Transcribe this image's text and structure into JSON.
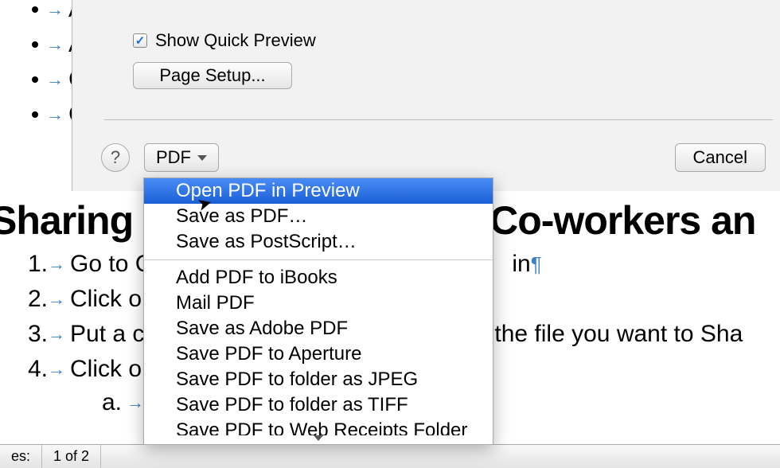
{
  "doc": {
    "bullets": [
      "A",
      "A",
      "C",
      "C"
    ],
    "heading_left": "Sharing",
    "heading_right": "Co-workers an",
    "num_items": {
      "1": "Go to C",
      "1_right": "in",
      "2": "Click on",
      "3_left": "Put a c",
      "3_right": "the file you want to Sha",
      "4": "Click on"
    },
    "sub_item": "a."
  },
  "dialog": {
    "show_preview_label": "Show Quick Preview",
    "page_setup_label": "Page Setup...",
    "help_label": "?",
    "pdf_label": "PDF",
    "cancel_label": "Cancel"
  },
  "menu": {
    "items": [
      "Open PDF in Preview",
      "Save as PDF…",
      "Save as PostScript…"
    ],
    "items2": [
      "Add PDF to iBooks",
      "Mail PDF",
      "Save as Adobe PDF",
      "Save PDF to Aperture",
      "Save PDF to folder as JPEG",
      "Save PDF to folder as TIFF"
    ],
    "cut_item": "Save PDF to Web Receipts Folder"
  },
  "status": {
    "prefix": "es:",
    "page": "1 of 2"
  }
}
